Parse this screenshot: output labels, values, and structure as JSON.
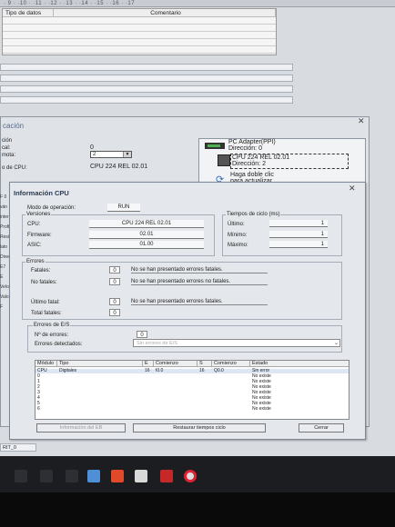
{
  "ruler_text": "· 9 · ·10 · ·11 · ·12 · ·13 · ·14 · ·15 · ·16 · ·17",
  "grid": {
    "col1": "Tipo de datos",
    "col2": "Comentario"
  },
  "comm": {
    "title": "cación",
    "label_a": "ción",
    "label_b": "cal:",
    "label_c": "mota:",
    "label_d": "o de CPU:",
    "local_value": "0",
    "remote_value": "2",
    "cpu_value": "CPU 224 REL 02.01",
    "pc_adapter": "PC Adapter(PPI)",
    "pc_address": "Dirección: 0",
    "cpu_name": "CPU 224 REL 02.01",
    "cpu_address": "Dirección: 2",
    "refresh_line1": "Haga doble clic",
    "refresh_line2": "para actualizar"
  },
  "left_cut": [
    "F 0",
    "ván",
    "inter",
    "Profi",
    "Resid",
    "lato",
    "Direc",
    "E7 E",
    "Velox",
    "Valo",
    "F"
  ],
  "cpu": {
    "title": "Información CPU",
    "mode_label": "Modo de operación:",
    "mode_value": "RUN",
    "versions_label": "Versiones",
    "cpu_label": "CPU:",
    "cpu_value": "CPU 224 REL 02.01",
    "firmware_label": "Firmware:",
    "firmware_value": "02.01",
    "asic_label": "ASIC:",
    "asic_value": "01.00",
    "cycle_label": "Tiempos de ciclo (ms)",
    "last_label": "Último:",
    "last_value": "1",
    "min_label": "Mínimo:",
    "min_value": "1",
    "max_label": "Máximo:",
    "max_value": "1",
    "errors_label": "Errores",
    "fatal_label": "Fatales:",
    "fatal_value": "0",
    "fatal_msg": "No se han presentado errores fatales.",
    "nonfatal_label": "No fatales:",
    "nonfatal_value": "0",
    "nonfatal_msg": "No se han presentado errores no fatales.",
    "last_fatal_label": "Último fatal:",
    "last_fatal_value": "0",
    "last_fatal_msg": "No se han presentado errores fatales.",
    "total_fatal_label": "Total fatales:",
    "total_fatal_value": "0",
    "io_label": "Errores de E/S",
    "io_count_label": "Nº de errores:",
    "io_count_value": "0",
    "io_detected_label": "Errores detectados:",
    "io_detected_value": "Sin errores de E/S",
    "btn_eb": "Información del EB",
    "btn_reset": "Restaurar tiempos ciclo",
    "btn_close": "Cerrar"
  },
  "table": {
    "headers": [
      "Módulo",
      "Tipo",
      "E",
      "Comienzo",
      "S",
      "Comienzo",
      "Estado"
    ],
    "rows": [
      [
        "CPU",
        "Digitales",
        "16",
        "I0.0",
        "16",
        "Q0.0",
        "Sin error"
      ],
      [
        "0",
        "",
        "",
        "",
        "",
        "",
        "No existe"
      ],
      [
        "1",
        "",
        "",
        "",
        "",
        "",
        "No existe"
      ],
      [
        "2",
        "",
        "",
        "",
        "",
        "",
        "No existe"
      ],
      [
        "3",
        "",
        "",
        "",
        "",
        "",
        "No existe"
      ],
      [
        "4",
        "",
        "",
        "",
        "",
        "",
        "No existe"
      ],
      [
        "5",
        "",
        "",
        "",
        "",
        "",
        "No existe"
      ],
      [
        "6",
        "",
        "",
        "",
        "",
        "",
        "No existe"
      ]
    ]
  },
  "bottom_tab": "RIT_0",
  "colors": {
    "accent": "#3a6fc4",
    "taskbar": "#1b1d21"
  },
  "taskbar_icons": [
    "windows-icon",
    "search-icon",
    "task-view-icon",
    "visual-studio-icon",
    "office-icon",
    "3d-viewer-icon",
    "red-app-icon",
    "chrome-icon"
  ]
}
